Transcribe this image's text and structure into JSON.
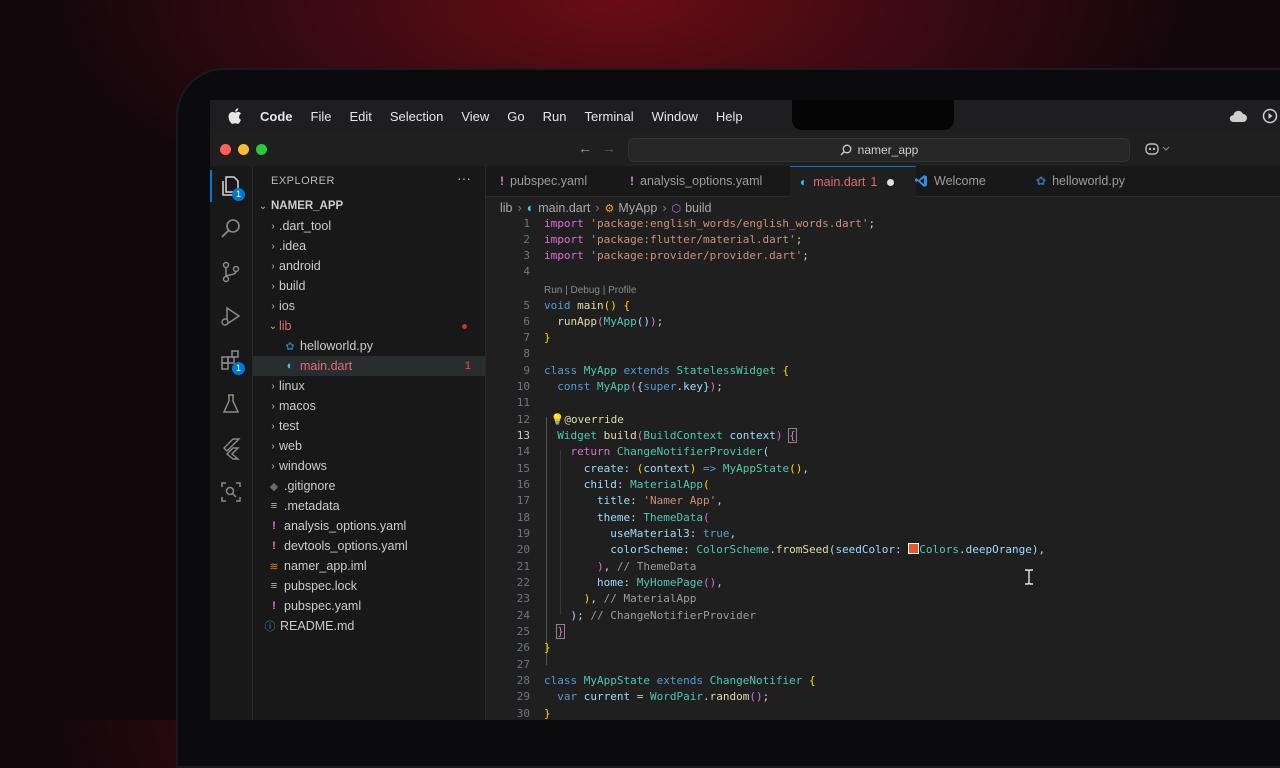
{
  "menubar": {
    "items": [
      "Code",
      "File",
      "Edit",
      "Selection",
      "View",
      "Go",
      "Run",
      "Terminal",
      "Window",
      "Help"
    ]
  },
  "titlebar": {
    "search": "namer_app"
  },
  "explorer": {
    "title": "EXPLORER",
    "more": "···",
    "root": "NAMER_APP",
    "items": [
      {
        "name": ".dart_tool",
        "type": "folder"
      },
      {
        "name": ".idea",
        "type": "folder"
      },
      {
        "name": "android",
        "type": "folder"
      },
      {
        "name": "build",
        "type": "folder"
      },
      {
        "name": "ios",
        "type": "folder"
      },
      {
        "name": "lib",
        "type": "folder-open"
      },
      {
        "name": "helloworld.py",
        "type": "python"
      },
      {
        "name": "main.dart",
        "type": "dart",
        "badge": "1"
      },
      {
        "name": "linux",
        "type": "folder"
      },
      {
        "name": "macos",
        "type": "folder"
      },
      {
        "name": "test",
        "type": "folder"
      },
      {
        "name": "web",
        "type": "folder"
      },
      {
        "name": "windows",
        "type": "folder"
      },
      {
        "name": ".gitignore",
        "type": "git"
      },
      {
        "name": ".metadata",
        "type": "text"
      },
      {
        "name": "analysis_options.yaml",
        "type": "yaml"
      },
      {
        "name": "devtools_options.yaml",
        "type": "yaml"
      },
      {
        "name": "namer_app.iml",
        "type": "rss"
      },
      {
        "name": "pubspec.lock",
        "type": "text"
      },
      {
        "name": "pubspec.yaml",
        "type": "yaml"
      },
      {
        "name": "README.md",
        "type": "info"
      }
    ]
  },
  "activity_badges": {
    "explorer": "1",
    "extensions": "1"
  },
  "tabs": [
    {
      "label": "pubspec.yaml",
      "icon": "!"
    },
    {
      "label": "analysis_options.yaml",
      "icon": "!"
    },
    {
      "label": "main.dart",
      "badge": "1",
      "icon": "dart"
    },
    {
      "label": "Welcome",
      "icon": "vscode"
    },
    {
      "label": "helloworld.py",
      "icon": "python"
    }
  ],
  "breadcrumb": [
    "lib",
    "main.dart",
    "MyApp",
    "build"
  ],
  "codelens": "Run | Debug | Profile",
  "code_lines": [
    "import 'package:english_words/english_words.dart';",
    "import 'package:flutter/material.dart';",
    "import 'package:provider/provider.dart';",
    "",
    "void main() {",
    "  runApp(MyApp());",
    "}",
    "",
    "class MyApp extends StatelessWidget {",
    "  const MyApp({super.key});",
    "",
    "  @override",
    "  Widget build(BuildContext context) {",
    "    return ChangeNotifierProvider(",
    "      create: (context) => MyAppState(),",
    "      child: MaterialApp(",
    "        title: 'Namer App',",
    "        theme: ThemeData(",
    "          useMaterial3: true,",
    "          colorScheme: ColorScheme.fromSeed(seedColor: Colors.deepOrange),",
    "        ), // ThemeData",
    "        home: MyHomePage(),",
    "      ), // MaterialApp",
    "    ); // ChangeNotifierProvider",
    "  }",
    "}",
    "",
    "class MyAppState extends ChangeNotifier {",
    "  var current = WordPair.random();",
    "}"
  ],
  "current_line": 13,
  "colors": {
    "accent": "#0078d4",
    "error": "#f14c4c",
    "deep_orange_swatch": "#e8562a"
  }
}
